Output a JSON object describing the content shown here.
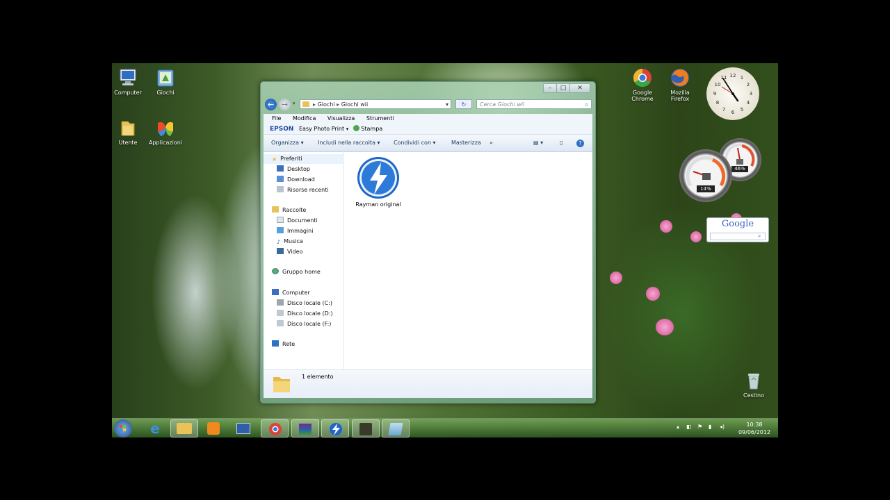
{
  "desktop": {
    "icons_left": [
      {
        "label": "Computer"
      },
      {
        "label": "Giochi"
      },
      {
        "label": "Utente"
      },
      {
        "label": "Applicazioni"
      }
    ],
    "icons_right": [
      {
        "label": "Google Chrome"
      },
      {
        "label": "Mozilla Firefox"
      }
    ],
    "recycle_bin": "Cestino"
  },
  "window": {
    "address": {
      "crumb1": "Giochi",
      "crumb2": "Giochi wii",
      "search_placeholder": "Cerca Giochi wii"
    },
    "menu": [
      "File",
      "Modifica",
      "Visualizza",
      "Strumenti"
    ],
    "epson": {
      "brand": "EPSON",
      "app": "Easy Photo Print",
      "print": "Stampa"
    },
    "toolbar": {
      "organize": "Organizza",
      "include": "Includi nella raccolta",
      "share": "Condividi con",
      "burn": "Masterizza",
      "more": "»"
    },
    "nav": {
      "favorites": "Preferiti",
      "desktop": "Desktop",
      "download": "Download",
      "recent": "Risorse recenti",
      "libraries": "Raccolte",
      "documents": "Documenti",
      "images": "Immagini",
      "music": "Musica",
      "video": "Video",
      "homegroup": "Gruppo home",
      "computer": "Computer",
      "disk_c": "Disco locale (C:)",
      "disk_d": "Disco locale (D:)",
      "disk_f": "Disco locale (F:)",
      "network": "Rete"
    },
    "items": [
      {
        "label": "Rayman original"
      }
    ],
    "status": "1 elemento"
  },
  "gadgets": {
    "cpu": "14%",
    "memory": "46%",
    "google": "Google",
    "clock_time": "10:38"
  },
  "taskbar": {
    "time": "10:38",
    "date": "09/06/2012"
  },
  "colors": {
    "accent": "#1e395b",
    "favorites_star": "#f2b43a"
  }
}
